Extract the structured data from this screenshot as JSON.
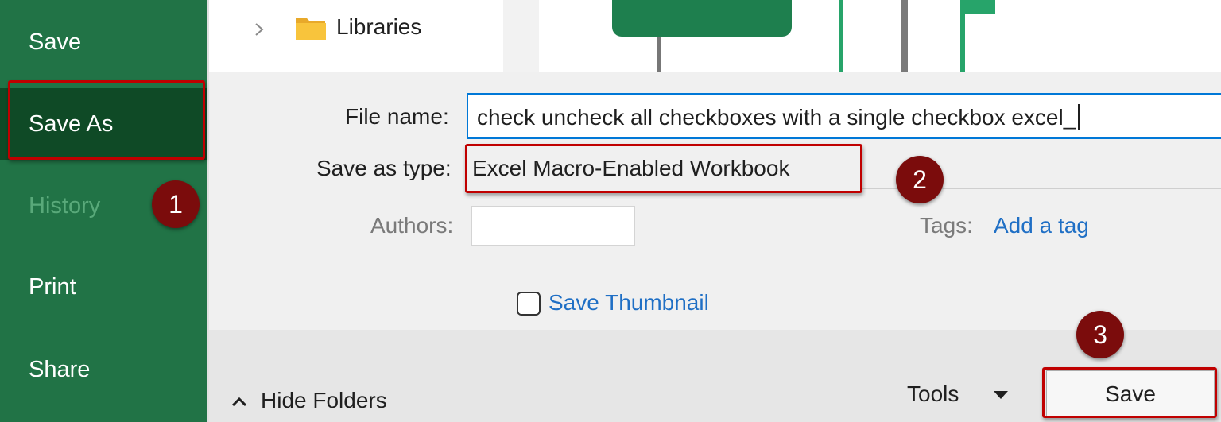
{
  "sidebar": {
    "items": [
      {
        "label": "Save"
      },
      {
        "label": "Save As"
      },
      {
        "label": "History"
      },
      {
        "label": "Print"
      },
      {
        "label": "Share"
      }
    ]
  },
  "folder_tree": {
    "item": {
      "label": "Libraries",
      "icon": "folder-icon"
    }
  },
  "form": {
    "file_name_label": "File name:",
    "file_name_value": "check uncheck all checkboxes with a single checkbox excel_",
    "save_type_label": "Save as type:",
    "save_type_value": "Excel Macro-Enabled Workbook",
    "authors_label": "Authors:",
    "tags_label": "Tags:",
    "tags_link": "Add a tag",
    "thumbnail_label": "Save Thumbnail",
    "thumbnail_checked": false
  },
  "footer": {
    "hide_folders_label": "Hide Folders",
    "tools_label": "Tools",
    "save_label": "Save"
  },
  "annotations": {
    "steps": [
      "1",
      "2",
      "3"
    ]
  },
  "colors": {
    "sidebar_bg": "#217346",
    "sidebar_active": "#0f4a26",
    "highlight": "#c00000",
    "badge": "#7b0c0c",
    "link": "#1f6fc5",
    "input_focus": "#0078d7"
  }
}
